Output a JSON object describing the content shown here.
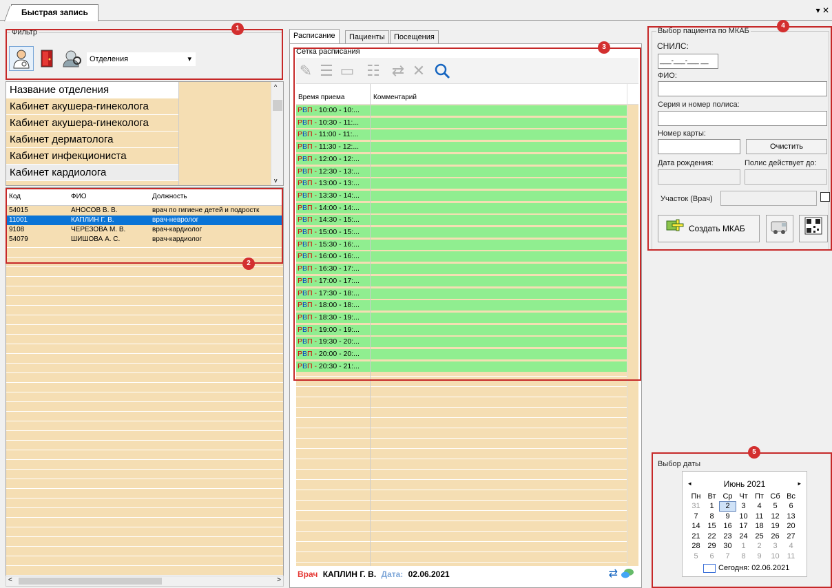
{
  "window": {
    "tab_title": "Быстрая запись",
    "pin_glyph": "▾",
    "close_glyph": "✕"
  },
  "filter": {
    "title": "Фильтр",
    "icons": [
      "doctor-icon",
      "door-icon",
      "department-search-icon"
    ],
    "dropdown_value": "Отделения"
  },
  "departments": {
    "header": "Название отделения",
    "rows": [
      "Кабинет акушера-гинеколога",
      "Кабинет акушера-гинеколога",
      "Кабинет дерматолога",
      "Кабинет инфекциониста",
      "Кабинет кардиолога"
    ],
    "selected_index": 4
  },
  "doctors": {
    "columns": [
      "Код",
      "ФИО",
      "Должность"
    ],
    "rows": [
      {
        "code": "54015",
        "name": "АНОСОВ В. В.",
        "position": "врач по гигиене детей и подростк"
      },
      {
        "code": "11001",
        "name": "КАПЛИН Г. В.",
        "position": "врач-невролог"
      },
      {
        "code": "9108",
        "name": "ЧЕРЕЗОВА М. В.",
        "position": "врач-кардиолог"
      },
      {
        "code": "54079",
        "name": "ШИШОВА А. С.",
        "position": "врач-кардиолог"
      }
    ],
    "selected_index": 1
  },
  "center": {
    "tabs": [
      "Расписание",
      "Пациенты",
      "Посещения"
    ],
    "active_tab": 0,
    "schedule_title": "Сетка расписания",
    "columns": [
      "Время приема",
      "Комментарий"
    ],
    "slots": [
      "10:00 - 10:...",
      "10:30 - 11:...",
      "11:00 - 11:...",
      "11:30 - 12:...",
      "12:00 - 12:...",
      "12:30 - 13:...",
      "13:00 - 13:...",
      "13:30 - 14:...",
      "14:00 - 14:...",
      "14:30 - 15:...",
      "15:00 - 15:...",
      "15:30 - 16:...",
      "16:00 - 16:...",
      "16:30 - 17:...",
      "17:00 - 17:...",
      "17:30 - 18:...",
      "18:00 - 18:...",
      "18:30 - 19:...",
      "19:00 - 19:...",
      "19:30 - 20:...",
      "20:00 - 20:...",
      "20:30 - 21:..."
    ],
    "slot_prefix_r": "Р",
    "slot_prefix_rest": "В",
    "slot_prefix_p": "П",
    "slot_dash": " - ",
    "status": {
      "doctor_label": "Врач",
      "doctor_value": "КАПЛИН Г. В.",
      "date_label": "Дата:",
      "date_value": "02.06.2021"
    }
  },
  "patient": {
    "title": "Выбор пациента по МКАБ",
    "snils_label": "СНИЛС:",
    "snils_mask": "___-___-___ __",
    "fio_label": "ФИО:",
    "policy_label": "Серия и номер полиса:",
    "card_label": "Номер карты:",
    "clear_button": "Очистить",
    "birth_label": "Дата рождения:",
    "policy_until_label": "Полис действует до:",
    "district_label": "Участок (Врач)",
    "create_button": "Создать МКАБ"
  },
  "date_picker": {
    "title": "Выбор даты",
    "month": "Июнь 2021",
    "weekdays": [
      "Пн",
      "Вт",
      "Ср",
      "Чт",
      "Пт",
      "Сб",
      "Вс"
    ],
    "weeks": [
      [
        "31",
        "1",
        "2",
        "3",
        "4",
        "5",
        "6"
      ],
      [
        "7",
        "8",
        "9",
        "10",
        "11",
        "12",
        "13"
      ],
      [
        "14",
        "15",
        "16",
        "17",
        "18",
        "19",
        "20"
      ],
      [
        "21",
        "22",
        "23",
        "24",
        "25",
        "26",
        "27"
      ],
      [
        "28",
        "29",
        "30",
        "1",
        "2",
        "3",
        "4"
      ],
      [
        "5",
        "6",
        "7",
        "8",
        "9",
        "10",
        "11"
      ]
    ],
    "selected_day": "2",
    "today_label": "Сегодня: 02.06.2021"
  },
  "callouts": [
    "1",
    "2",
    "3",
    "4",
    "5"
  ],
  "colors": {
    "callout": "#d32f2f",
    "row_bg": "#f5deb3",
    "slot_green": "#90ee90",
    "selection": "#0a74d6"
  }
}
